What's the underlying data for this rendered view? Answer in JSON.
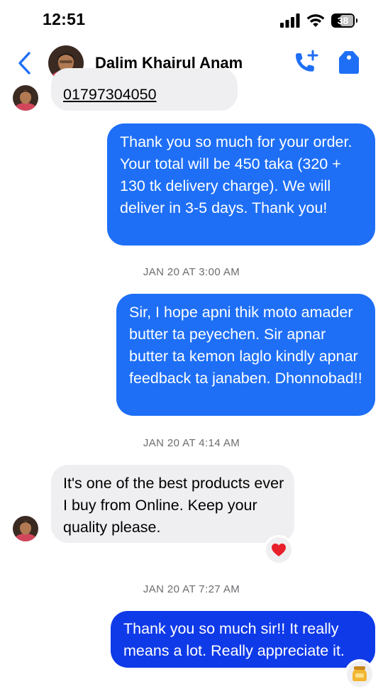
{
  "status_bar": {
    "time": "12:51",
    "battery_level": "38"
  },
  "header": {
    "contact_name": "Dalim Khairul Anam"
  },
  "messages": [
    {
      "text": "01797304050"
    },
    {
      "text": "Thank you so much for your order. Your total will be 450 taka (320 + 130 tk delivery charge). We will deliver in 3-5 days. Thank you!"
    },
    {
      "timestamp": "JAN 20 AT 3:00 AM"
    },
    {
      "text": "Sir, I hope apni thik moto amader butter ta peyechen. Sir apnar butter ta kemon laglo kindly apnar feedback ta janaben. Dhonnobad!!"
    },
    {
      "timestamp": "JAN 20 AT 4:14 AM"
    },
    {
      "text": "It's one of the best products ever I buy from Online.  Keep your quality please.",
      "reaction": "heart"
    },
    {
      "timestamp": "JAN 20 AT 7:27 AM"
    },
    {
      "text": "Thank you so much sir!! It really means a lot. Really appreciate it.",
      "reaction": "honey-jar"
    }
  ],
  "colors": {
    "outgoing_bubble": "#1e6ff6",
    "outgoing_bubble_latest": "#0f3ae8",
    "incoming_bubble": "#efeff1",
    "accent": "#1e6ff6",
    "heart": "#e8202c"
  }
}
